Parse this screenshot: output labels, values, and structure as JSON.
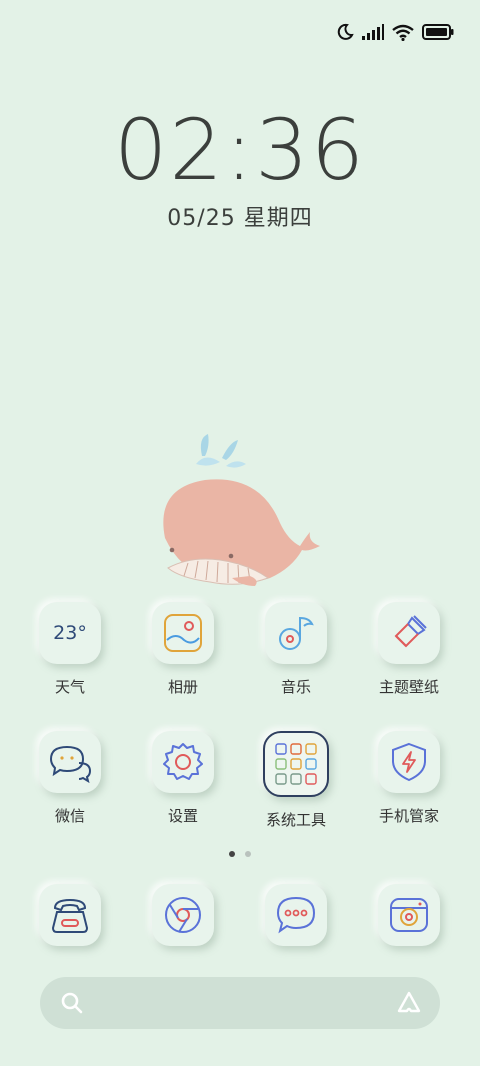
{
  "status": {
    "icons": [
      "moon-icon",
      "signal-icon",
      "wifi-icon",
      "battery-icon"
    ]
  },
  "clock": {
    "time": "02:36",
    "date": "05/25 星期四"
  },
  "home": {
    "row1": [
      {
        "label": "天气",
        "icon": "weather-icon",
        "value": "23°"
      },
      {
        "label": "相册",
        "icon": "gallery-icon"
      },
      {
        "label": "音乐",
        "icon": "music-icon"
      },
      {
        "label": "主题壁纸",
        "icon": "themes-icon"
      }
    ],
    "row2": [
      {
        "label": "微信",
        "icon": "wechat-icon"
      },
      {
        "label": "设置",
        "icon": "settings-icon"
      },
      {
        "label": "系统工具",
        "icon": "folder-icon"
      },
      {
        "label": "手机管家",
        "icon": "security-icon"
      }
    ]
  },
  "pager": {
    "pages": 2,
    "current": 1
  },
  "dock": [
    {
      "icon": "phone-icon"
    },
    {
      "icon": "browser-icon"
    },
    {
      "icon": "messages-icon"
    },
    {
      "icon": "camera-icon"
    }
  ],
  "colors": {
    "background": "#e3f2e7",
    "whale": "#eab5a5",
    "tile": "#e8f4ec",
    "search": "#cfe0d5"
  }
}
